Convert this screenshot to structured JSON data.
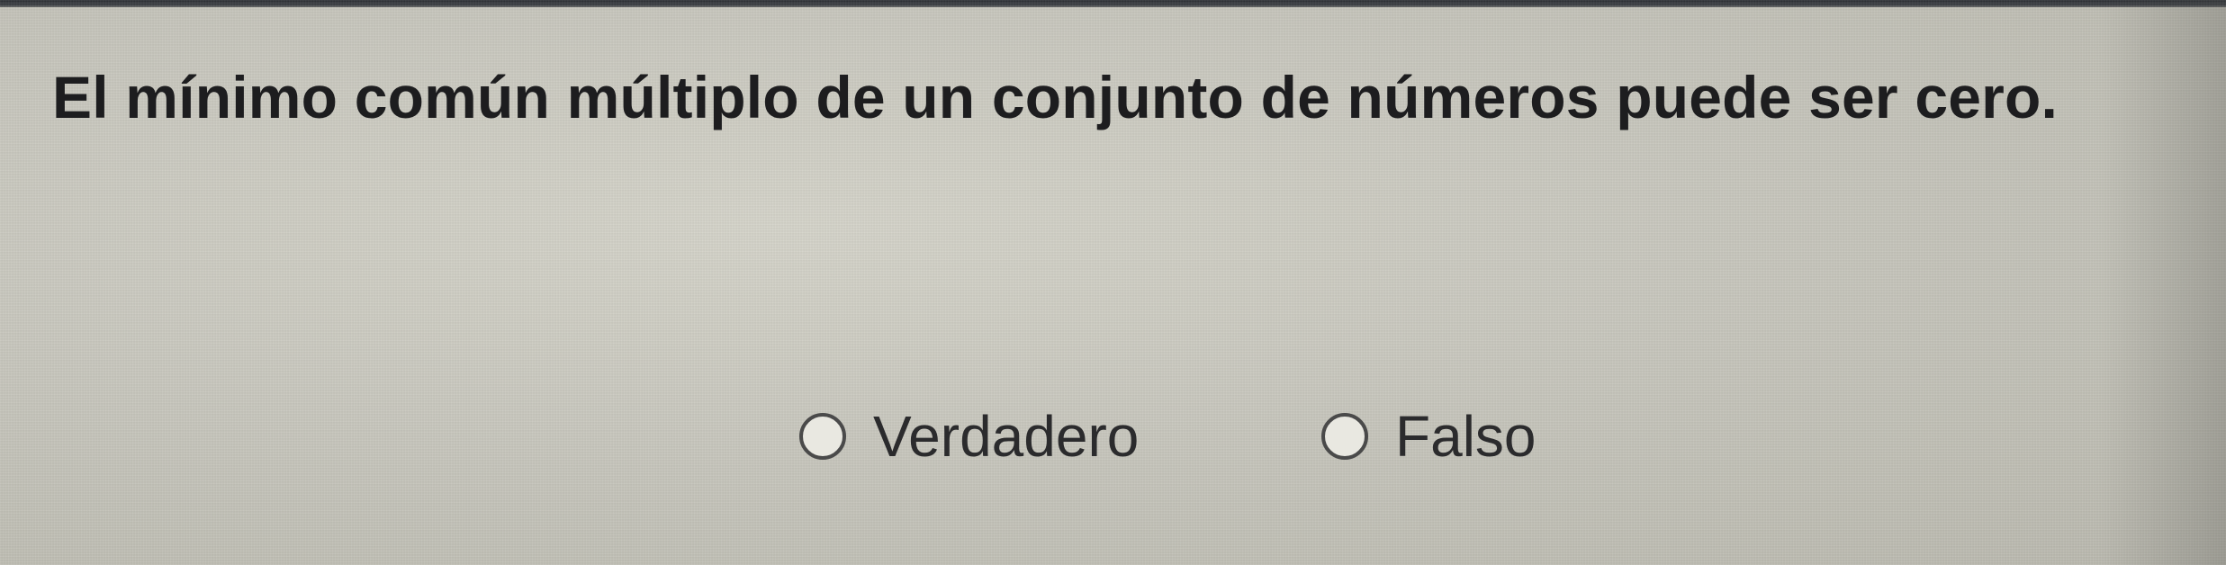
{
  "question": {
    "text": "El mínimo común múltiplo de un conjunto de números puede ser cero."
  },
  "options": [
    {
      "label": "Verdadero",
      "selected": false
    },
    {
      "label": "Falso",
      "selected": false
    }
  ],
  "colors": {
    "background": "#c6c5bb",
    "text": "#1d1d1f",
    "radio_border": "#4a4a4a"
  }
}
